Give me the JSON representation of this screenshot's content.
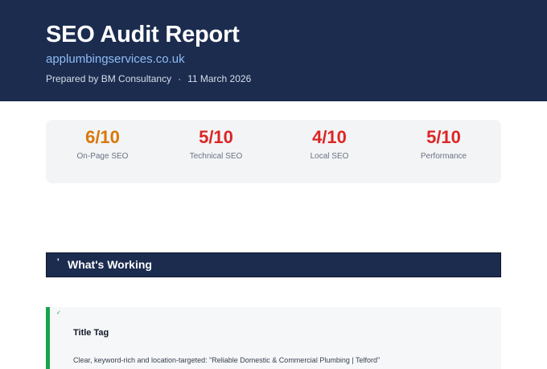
{
  "header": {
    "title": "SEO Audit Report",
    "url": "applumbingservices.co.uk",
    "prepared_by": "Prepared by BM Consultancy",
    "separator": "·",
    "date": "11 March 2026"
  },
  "scores": [
    {
      "value": "6/10",
      "label": "On-Page SEO",
      "color": "#d97706"
    },
    {
      "value": "5/10",
      "label": "Technical SEO",
      "color": "#dc2626"
    },
    {
      "value": "4/10",
      "label": "Local SEO",
      "color": "#dc2626"
    },
    {
      "value": "5/10",
      "label": "Performance",
      "color": "#dc2626"
    }
  ],
  "section": {
    "title": "What's Working",
    "marker": "'"
  },
  "card": {
    "marker": "✓",
    "title": "Title Tag",
    "text": "Clear, keyword-rich and location-targeted: \"Reliable Domestic & Commercial Plumbing | Telford\""
  },
  "colors": {
    "header_bg": "#1b2c4f",
    "url": "#8fbcf5",
    "good": "#16a34a",
    "warn": "#d97706",
    "bad": "#dc2626"
  }
}
